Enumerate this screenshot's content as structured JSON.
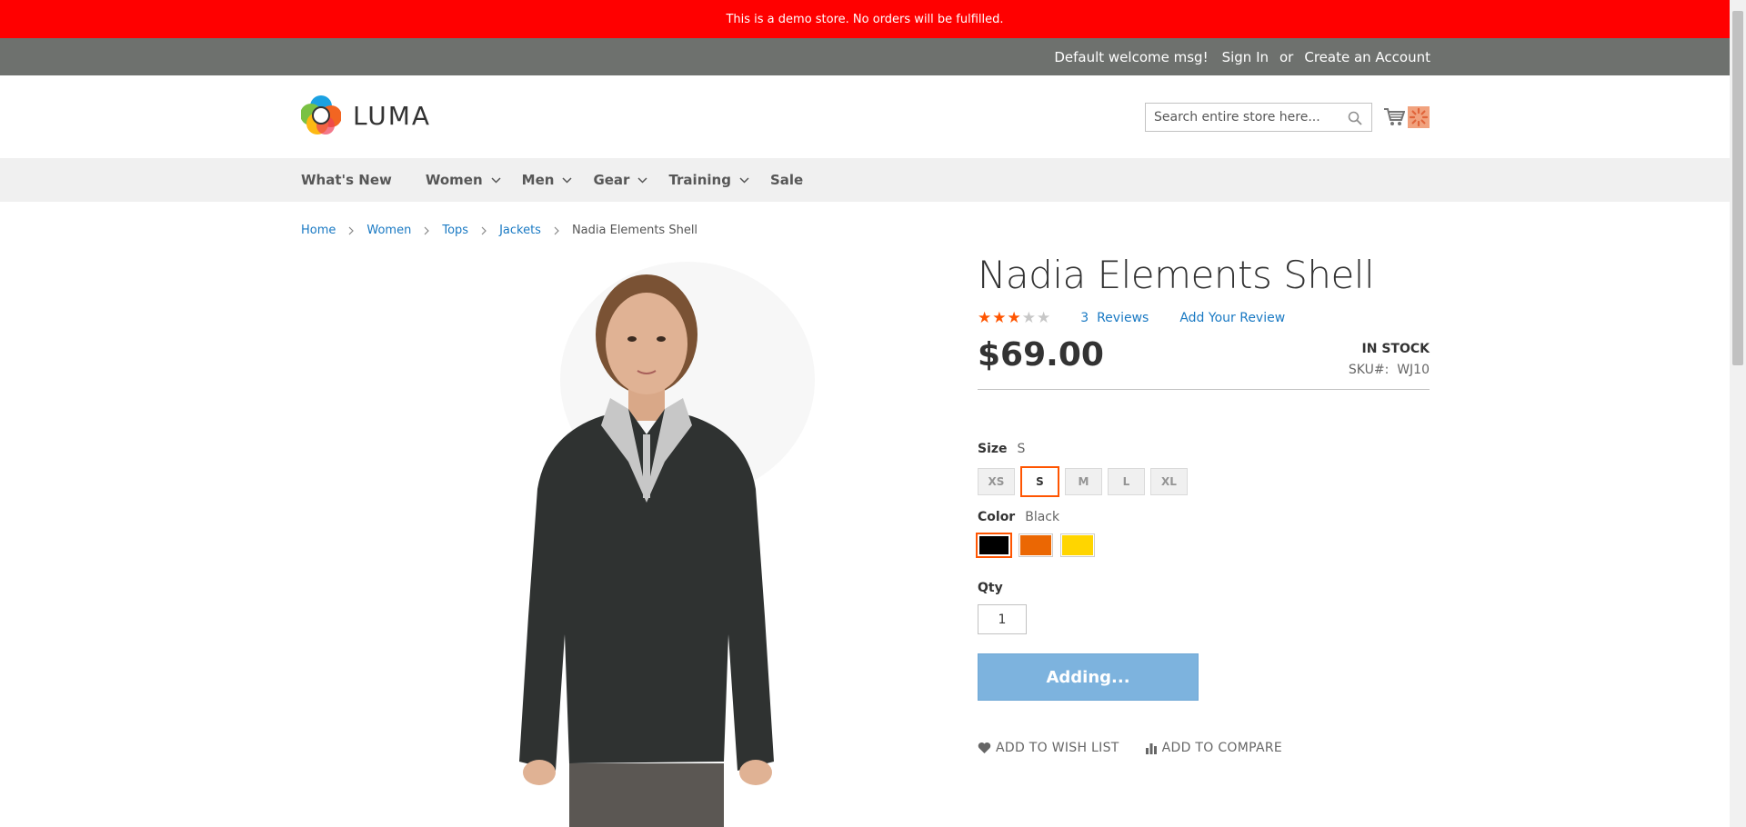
{
  "notice": {
    "text": "This is a demo store. No orders will be fulfilled."
  },
  "header_panel": {
    "welcome": "Default welcome msg!",
    "sign_in": "Sign In",
    "or": "or",
    "create_account": "Create an Account"
  },
  "logo": {
    "text": "LUMA"
  },
  "search": {
    "placeholder": "Search entire store here..."
  },
  "nav": {
    "items": [
      {
        "label": "What's New",
        "has_dropdown": false
      },
      {
        "label": "Women",
        "has_dropdown": true
      },
      {
        "label": "Men",
        "has_dropdown": true
      },
      {
        "label": "Gear",
        "has_dropdown": true
      },
      {
        "label": "Training",
        "has_dropdown": true
      },
      {
        "label": "Sale",
        "has_dropdown": false
      }
    ]
  },
  "breadcrumbs": {
    "home": "Home",
    "women": "Women",
    "tops": "Tops",
    "jackets": "Jackets",
    "current": "Nadia Elements Shell"
  },
  "product": {
    "title": "Nadia Elements Shell",
    "rating_stars": 3,
    "rating_max": 5,
    "reviews_count": "3",
    "reviews_label": "Reviews",
    "add_review": "Add Your Review",
    "price": "$69.00",
    "stock": "IN STOCK",
    "sku_label": "SKU#:",
    "sku": "WJ10",
    "size_label": "Size",
    "size_selected": "S",
    "sizes": [
      "XS",
      "S",
      "M",
      "L",
      "XL"
    ],
    "color_label": "Color",
    "color_selected": "Black",
    "colors": [
      "#000000",
      "#eb6703",
      "#ffd500"
    ],
    "qty_label": "Qty",
    "qty_value": "1",
    "add_button": "Adding...",
    "wishlist": "Add to Wish List",
    "compare": "Add to Compare"
  },
  "colors": {
    "notice_bg": "#ff0000",
    "panel_bg": "#6e716e",
    "accent": "#ff5501",
    "link": "#1979c3",
    "button": "#7db3de"
  }
}
